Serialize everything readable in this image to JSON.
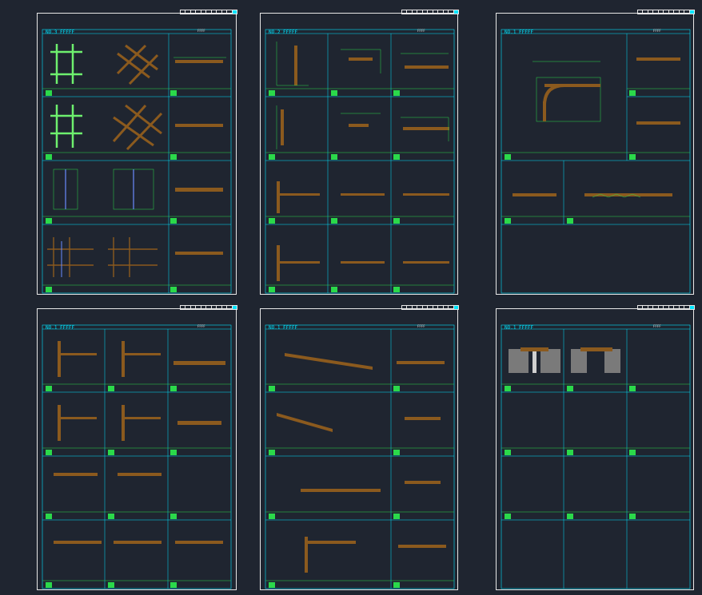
{
  "sheets": [
    {
      "title": "NO.3 FFFFF",
      "right": "FFFF",
      "cells": [
        "1",
        "2",
        "3",
        "4",
        "5",
        "6",
        "7",
        "8"
      ],
      "captions": [
        "",
        "",
        "",
        "",
        "",
        "",
        "",
        ""
      ]
    },
    {
      "title": "NO.2 FFFFF",
      "right": "FFFF",
      "cells": [
        "9",
        "10",
        "11",
        "12",
        "13",
        "14",
        "15",
        "16",
        "17",
        "18",
        "19",
        "20"
      ],
      "captions": [
        "",
        "",
        "",
        "",
        "",
        "",
        "",
        "",
        "",
        "",
        "",
        ""
      ]
    },
    {
      "title": "NO.1 FFFFF",
      "right": "FFFF",
      "cells": [
        "21",
        "22",
        "23",
        "24",
        "25"
      ],
      "captions": [
        "",
        "",
        "",
        "",
        "",
        ""
      ]
    },
    {
      "title": "NO.1 FFFFF",
      "right": "FFFF",
      "cells": [
        "26",
        "27",
        "28",
        "29",
        "30",
        "31",
        "32",
        "33",
        "34",
        "35",
        "36",
        "37"
      ],
      "captions": [
        "",
        "",
        "",
        "",
        "",
        "",
        "",
        "",
        "",
        "",
        "",
        ""
      ]
    },
    {
      "title": "NO.1 FFFFF",
      "right": "FFFF",
      "cells": [
        "38",
        "39",
        "40",
        "41",
        "42",
        "43",
        "44",
        "45"
      ],
      "captions": [
        "",
        "",
        "",
        "",
        "",
        "",
        "",
        ""
      ]
    },
    {
      "title": "NO.1 FFFFF",
      "right": "FFFF",
      "cells": [
        "1",
        "2",
        "3",
        "4",
        "5",
        "6",
        "7",
        "8",
        "9"
      ],
      "captions": [
        "",
        "",
        "",
        "",
        "",
        "",
        "",
        "",
        ""
      ]
    }
  ],
  "colors": {
    "background": "#1f2530",
    "frame": "#e8e8e8",
    "grid": "#00e5ff",
    "line": "#2bd94a",
    "wood": "#8b5a1e"
  }
}
